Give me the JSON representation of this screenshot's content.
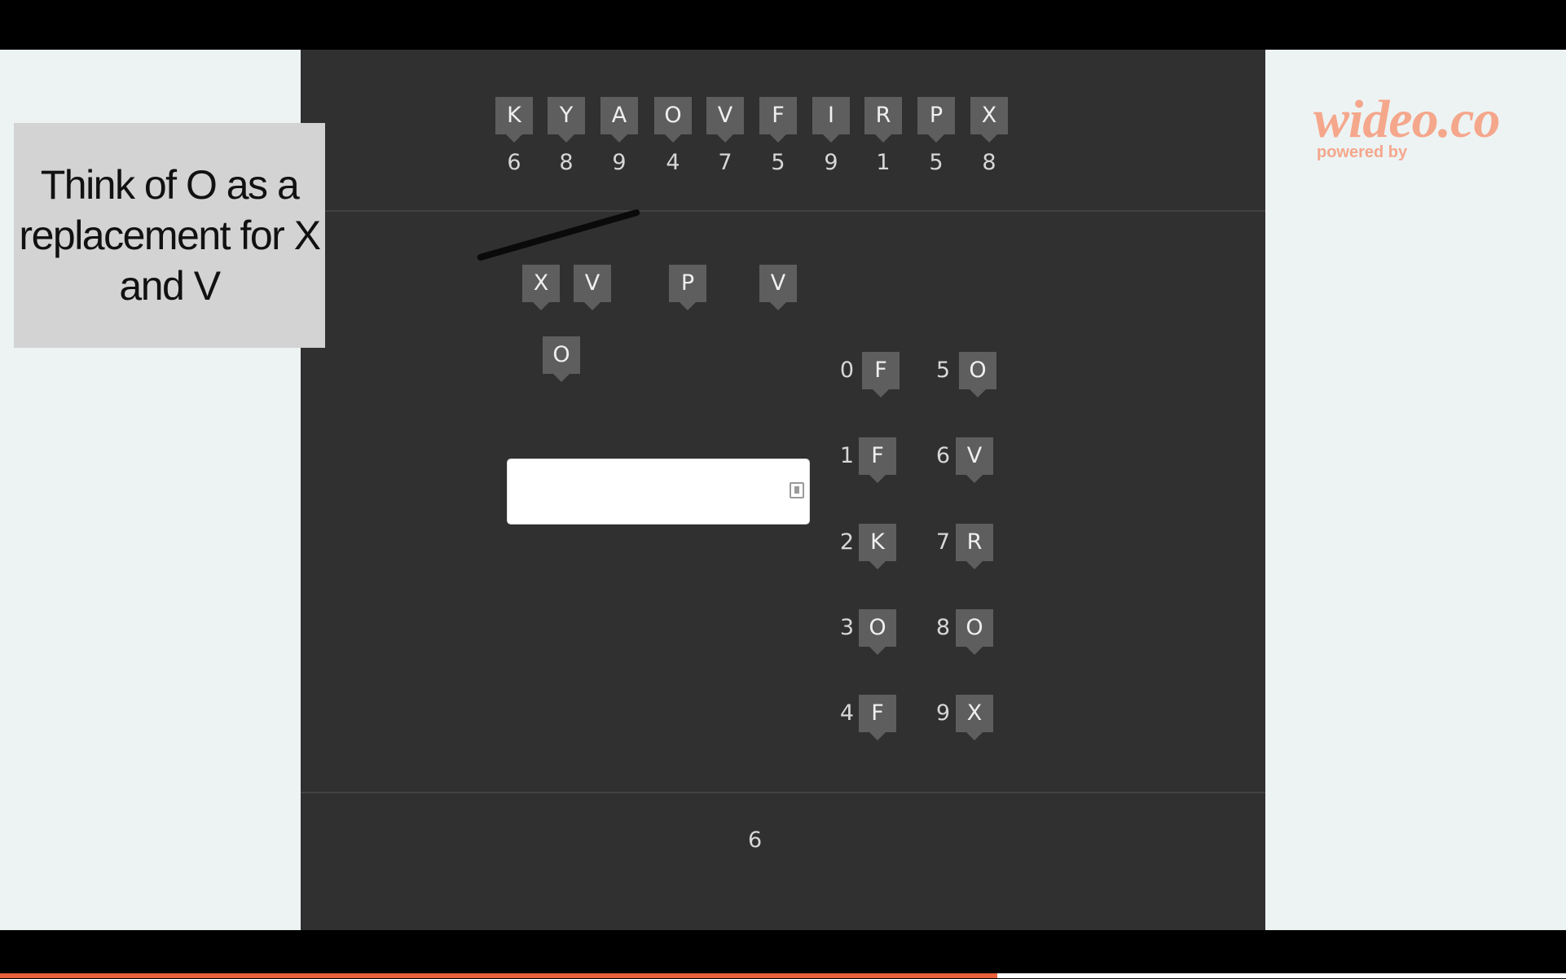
{
  "callout": {
    "text": "Think of O as a replacement for X and V"
  },
  "brand": {
    "logo": "wideo.co",
    "tagline": "powered by"
  },
  "code_tiles": [
    {
      "letter": "K",
      "number": "6"
    },
    {
      "letter": "Y",
      "number": "8"
    },
    {
      "letter": "A",
      "number": "9"
    },
    {
      "letter": "O",
      "number": "4"
    },
    {
      "letter": "V",
      "number": "7"
    },
    {
      "letter": "F",
      "number": "5"
    },
    {
      "letter": "I",
      "number": "9"
    },
    {
      "letter": "R",
      "number": "1"
    },
    {
      "letter": "P",
      "number": "5"
    },
    {
      "letter": "X",
      "number": "8"
    }
  ],
  "working_tiles": {
    "crossed": [
      "X",
      "V"
    ],
    "others": [
      "P",
      "V"
    ],
    "replacement": "O"
  },
  "answer_input": {
    "value": "",
    "placeholder": ""
  },
  "digit_map": [
    {
      "digit": "0",
      "letter": "F"
    },
    {
      "digit": "1",
      "letter": "F"
    },
    {
      "digit": "2",
      "letter": "K"
    },
    {
      "digit": "3",
      "letter": "O"
    },
    {
      "digit": "4",
      "letter": "F"
    },
    {
      "digit": "5",
      "letter": "O"
    },
    {
      "digit": "6",
      "letter": "V"
    },
    {
      "digit": "7",
      "letter": "R"
    },
    {
      "digit": "8",
      "letter": "O"
    },
    {
      "digit": "9",
      "letter": "X"
    }
  ],
  "footer": {
    "count": "6"
  },
  "video_progress": 0.637,
  "colors": {
    "panel": "#303030",
    "tile": "#5e5e5e",
    "brand": "#f5a78c",
    "progress": "#e8613a"
  },
  "icons": {
    "answer_input": "contact-card-icon"
  }
}
